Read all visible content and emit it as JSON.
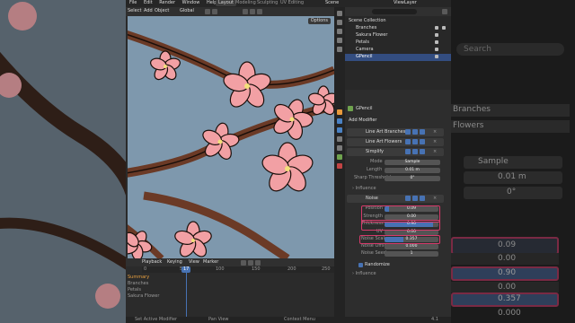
{
  "topbar": {
    "menus": [
      "File",
      "Edit",
      "Render",
      "Window",
      "Help"
    ],
    "workspaces": [
      "Layout",
      "Modeling",
      "Sculpting",
      "UV Editing"
    ],
    "scene_label": "Scene",
    "viewlayer_label": "ViewLayer"
  },
  "viewport": {
    "header_items": [
      "Select",
      "Add",
      "Object"
    ],
    "orientation": "Global",
    "options_label": "Options"
  },
  "outliner": {
    "root": "Scene Collection",
    "items": [
      "Branches",
      "Sakura Flower",
      "Petals",
      "Camera",
      "GPencil"
    ]
  },
  "properties": {
    "object_name": "GPencil",
    "add_modifier": "Add Modifier",
    "modifiers": [
      "Line Art Branches",
      "Line Art Flowers",
      "Simplify"
    ],
    "simplify": {
      "mode_label": "Mode",
      "mode_value": "Sample",
      "length_label": "Length",
      "length_value": "0.01 m",
      "sharp_label": "Sharp Threshold",
      "sharp_value": "0°"
    },
    "influence_label": "Influence",
    "noise": {
      "name": "Noise",
      "fields": [
        {
          "label": "Position",
          "value": "0.09",
          "fraction": 0.09
        },
        {
          "label": "Strength",
          "value": "0.00",
          "fraction": 0.0
        },
        {
          "label": "Thickness",
          "value": "0.90",
          "fraction": 0.9
        },
        {
          "label": "UV",
          "value": "0.00",
          "fraction": 0.0
        },
        {
          "label": "Noise Scale",
          "value": "0.357",
          "fraction": 0.357
        },
        {
          "label": "Noise Offset",
          "value": "0.000",
          "fraction": 0.0
        },
        {
          "label": "Noise Seed",
          "value": "1",
          "fraction": 0.0
        }
      ],
      "randomize_label": "Randomize",
      "influence_label": "Influence"
    }
  },
  "rightpanel": {
    "search_placeholder": "Search",
    "rows": [
      "Branches",
      "Flowers"
    ],
    "mode_value": "Sample",
    "length_value": "0.01 m",
    "sharp_value": "0°",
    "position_value": "0.09",
    "strength_value": "0.00",
    "thickness_value": "0.90",
    "uv_value": "0.00",
    "scale_value": "0.357",
    "offset_value": "0.000"
  },
  "timeline": {
    "menus": [
      "Playback",
      "Keying",
      "View",
      "Marker"
    ],
    "current_frame": "17",
    "ticks": [
      "0",
      "50",
      "100",
      "150",
      "200",
      "250"
    ],
    "tracks": [
      "Summary",
      "Branches",
      "Petals",
      "Sakura Flower"
    ]
  },
  "statusbar": {
    "items": [
      "Set Active Modifier",
      "Pan View",
      "Context Menu"
    ],
    "version": "4.1"
  },
  "colors": {
    "accent": "#4772b3",
    "highlight": "#d63a6a",
    "sky": "#7e98ad",
    "petal": "#f2a0a4"
  }
}
